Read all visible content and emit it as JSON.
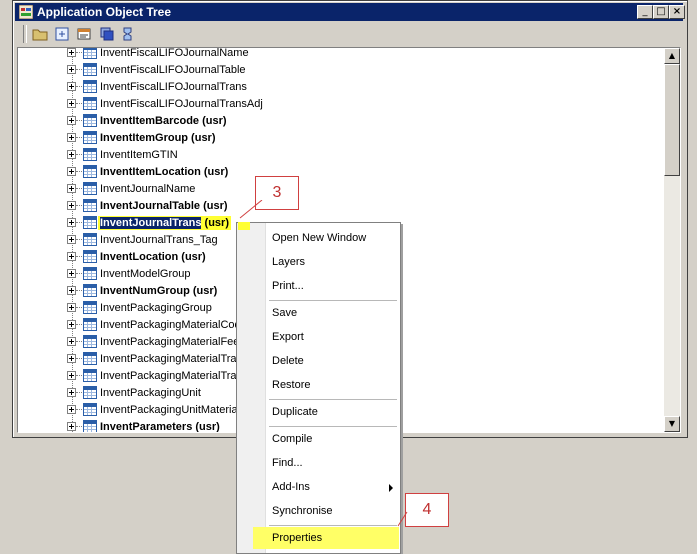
{
  "window": {
    "title": "Application Object Tree",
    "buttons": {
      "minimize": "_",
      "maximize": "□",
      "close": "×"
    }
  },
  "toolbar": {
    "tools": [
      "open-folder-icon",
      "new-node-icon",
      "properties-icon",
      "layers-icon",
      "compile-icon"
    ]
  },
  "tree": {
    "rows": [
      {
        "label": "InventFiscalLIFOJournalName",
        "bold": false
      },
      {
        "label": "InventFiscalLIFOJournalTable",
        "bold": false
      },
      {
        "label": "InventFiscalLIFOJournalTrans",
        "bold": false
      },
      {
        "label": "InventFiscalLIFOJournalTransAdj",
        "bold": false
      },
      {
        "label": "InventItemBarcode (usr)",
        "bold": true
      },
      {
        "label": "InventItemGroup (usr)",
        "bold": true
      },
      {
        "label": "InventItemGTIN",
        "bold": false
      },
      {
        "label": "InventItemLocation (usr)",
        "bold": true
      },
      {
        "label": "InventJournalName",
        "bold": false
      },
      {
        "label": "InventJournalTable (usr)",
        "bold": true
      },
      {
        "label": "InventJournalTrans (usr)",
        "bold": true,
        "selected": true,
        "sel_main": "InventJournalTrans",
        "sel_rest": " (usr)"
      },
      {
        "label": "InventJournalTrans_Tag",
        "bold": false
      },
      {
        "label": "InventLocation (usr)",
        "bold": true
      },
      {
        "label": "InventModelGroup",
        "bold": false
      },
      {
        "label": "InventNumGroup (usr)",
        "bold": true
      },
      {
        "label": "InventPackagingGroup",
        "bold": false
      },
      {
        "label": "InventPackagingMaterialCode",
        "bold": false
      },
      {
        "label": "InventPackagingMaterialFee",
        "bold": false
      },
      {
        "label": "InventPackagingMaterialTrans",
        "bold": false
      },
      {
        "label": "InventPackagingMaterialTrans",
        "bold": false
      },
      {
        "label": "InventPackagingUnit",
        "bold": false
      },
      {
        "label": "InventPackagingUnitMaterial",
        "bold": false
      },
      {
        "label": "InventParameters (usr)",
        "bold": true
      }
    ]
  },
  "context_menu": {
    "items": [
      {
        "label": "Open New Window"
      },
      {
        "label": "Layers"
      },
      {
        "label": "Print..."
      },
      {
        "separator": true
      },
      {
        "label": "Save"
      },
      {
        "label": "Export"
      },
      {
        "label": "Delete"
      },
      {
        "label": "Restore"
      },
      {
        "separator": true
      },
      {
        "label": "Duplicate"
      },
      {
        "separator": true
      },
      {
        "label": "Compile"
      },
      {
        "label": "Find..."
      },
      {
        "label": "Add-Ins",
        "submenu": true
      },
      {
        "label": "Synchronise"
      },
      {
        "separator": true
      },
      {
        "label": "Properties",
        "highlighted": true
      }
    ]
  },
  "callouts": {
    "step3": "3",
    "step4": "4"
  },
  "colors": {
    "titlebar": "#0a246a",
    "highlight": "#ffff33",
    "callout_border": "#d04040"
  }
}
